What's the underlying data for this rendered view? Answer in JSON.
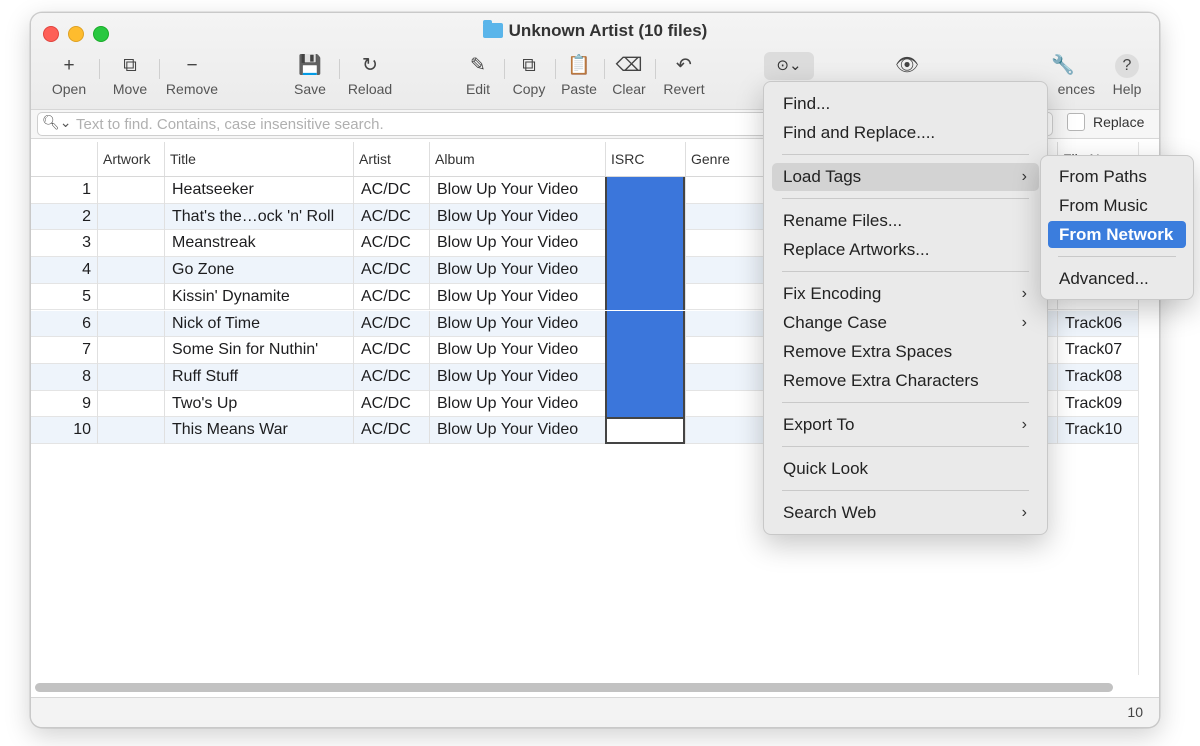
{
  "window": {
    "title": "Unknown Artist (10 files)"
  },
  "toolbar": {
    "open": "Open",
    "move": "Move",
    "remove": "Remove",
    "save": "Save",
    "reload": "Reload",
    "edit": "Edit",
    "copy": "Copy",
    "paste": "Paste",
    "clear": "Clear",
    "revert": "Revert",
    "preferences_partial": "ences",
    "help": "Help"
  },
  "search": {
    "placeholder": "Text to find. Contains, case insensitive search.",
    "replace_label": "Replace"
  },
  "table": {
    "columns": [
      "Artwork",
      "Title",
      "Artist",
      "Album",
      "ISRC",
      "Genre"
    ],
    "partial_column": "File N",
    "rows": [
      {
        "n": "1",
        "title": "Heatseeker",
        "artist": "AC/DC",
        "album": "Blow Up Your Video",
        "file": ""
      },
      {
        "n": "2",
        "title": "That's the…ock 'n' Roll",
        "artist": "AC/DC",
        "album": "Blow Up Your Video",
        "file": ""
      },
      {
        "n": "3",
        "title": "Meanstreak",
        "artist": "AC/DC",
        "album": "Blow Up Your Video",
        "file": ""
      },
      {
        "n": "4",
        "title": "Go Zone",
        "artist": "AC/DC",
        "album": "Blow Up Your Video",
        "file": ""
      },
      {
        "n": "5",
        "title": "Kissin' Dynamite",
        "artist": "AC/DC",
        "album": "Blow Up Your Video",
        "file": ""
      },
      {
        "n": "6",
        "title": "Nick of Time",
        "artist": "AC/DC",
        "album": "Blow Up Your Video",
        "file": "Track06"
      },
      {
        "n": "7",
        "title": "Some Sin for Nuthin'",
        "artist": "AC/DC",
        "album": "Blow Up Your Video",
        "file": "Track07"
      },
      {
        "n": "8",
        "title": "Ruff Stuff",
        "artist": "AC/DC",
        "album": "Blow Up Your Video",
        "file": "Track08"
      },
      {
        "n": "9",
        "title": "Two's Up",
        "artist": "AC/DC",
        "album": "Blow Up Your Video",
        "file": "Track09"
      },
      {
        "n": "10",
        "title": "This Means War",
        "artist": "AC/DC",
        "album": "Blow Up Your Video",
        "file": "Track10"
      }
    ]
  },
  "menu": {
    "find": "Find...",
    "find_replace": "Find and Replace....",
    "load_tags": "Load Tags",
    "rename_files": "Rename Files...",
    "replace_artworks": "Replace Artworks...",
    "fix_encoding": "Fix Encoding",
    "change_case": "Change Case",
    "remove_spaces": "Remove Extra Spaces",
    "remove_chars": "Remove Extra Characters",
    "export_to": "Export To",
    "quick_look": "Quick Look",
    "search_web": "Search Web"
  },
  "submenu": {
    "from_paths": "From Paths",
    "from_music": "From Music",
    "from_network": "From Network",
    "advanced": "Advanced..."
  },
  "status": {
    "count": "10"
  },
  "colors": {
    "selection": "#3b76db",
    "highlight": "#3b7ddd"
  }
}
